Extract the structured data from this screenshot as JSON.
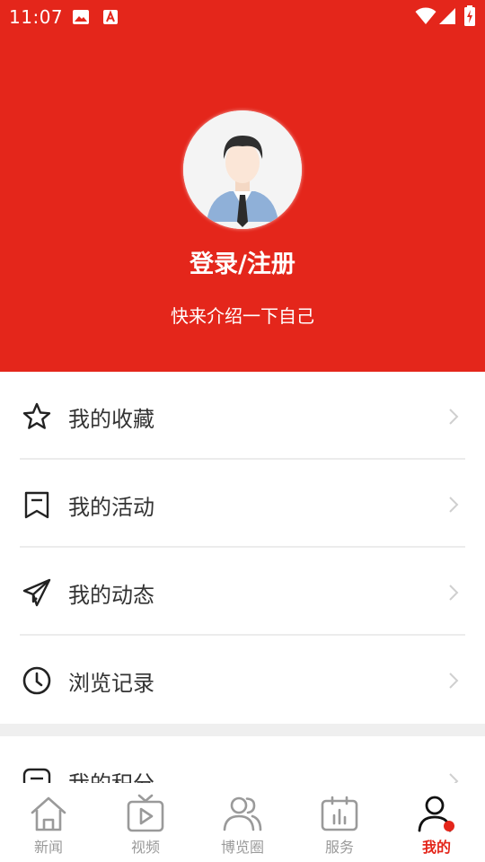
{
  "status_bar": {
    "time": "11:07"
  },
  "profile": {
    "login_label": "登录/注册",
    "bio": "快来介绍一下自己"
  },
  "menu": [
    {
      "label": "我的收藏",
      "icon": "star-icon"
    },
    {
      "label": "我的活动",
      "icon": "bookmark-icon"
    },
    {
      "label": "我的动态",
      "icon": "paper-plane-icon"
    },
    {
      "label": "浏览记录",
      "icon": "clock-icon"
    },
    {
      "label": "我的积分",
      "icon": "points-icon"
    }
  ],
  "tabs": [
    {
      "label": "新闻",
      "icon": "home-icon"
    },
    {
      "label": "视频",
      "icon": "tv-play-icon"
    },
    {
      "label": "博览圈",
      "icon": "people-icon"
    },
    {
      "label": "服务",
      "icon": "chart-calendar-icon"
    },
    {
      "label": "我的",
      "icon": "user-icon"
    }
  ],
  "colors": {
    "accent": "#e4261b",
    "tab_inactive": "#9a9a9a",
    "text": "#333333"
  }
}
